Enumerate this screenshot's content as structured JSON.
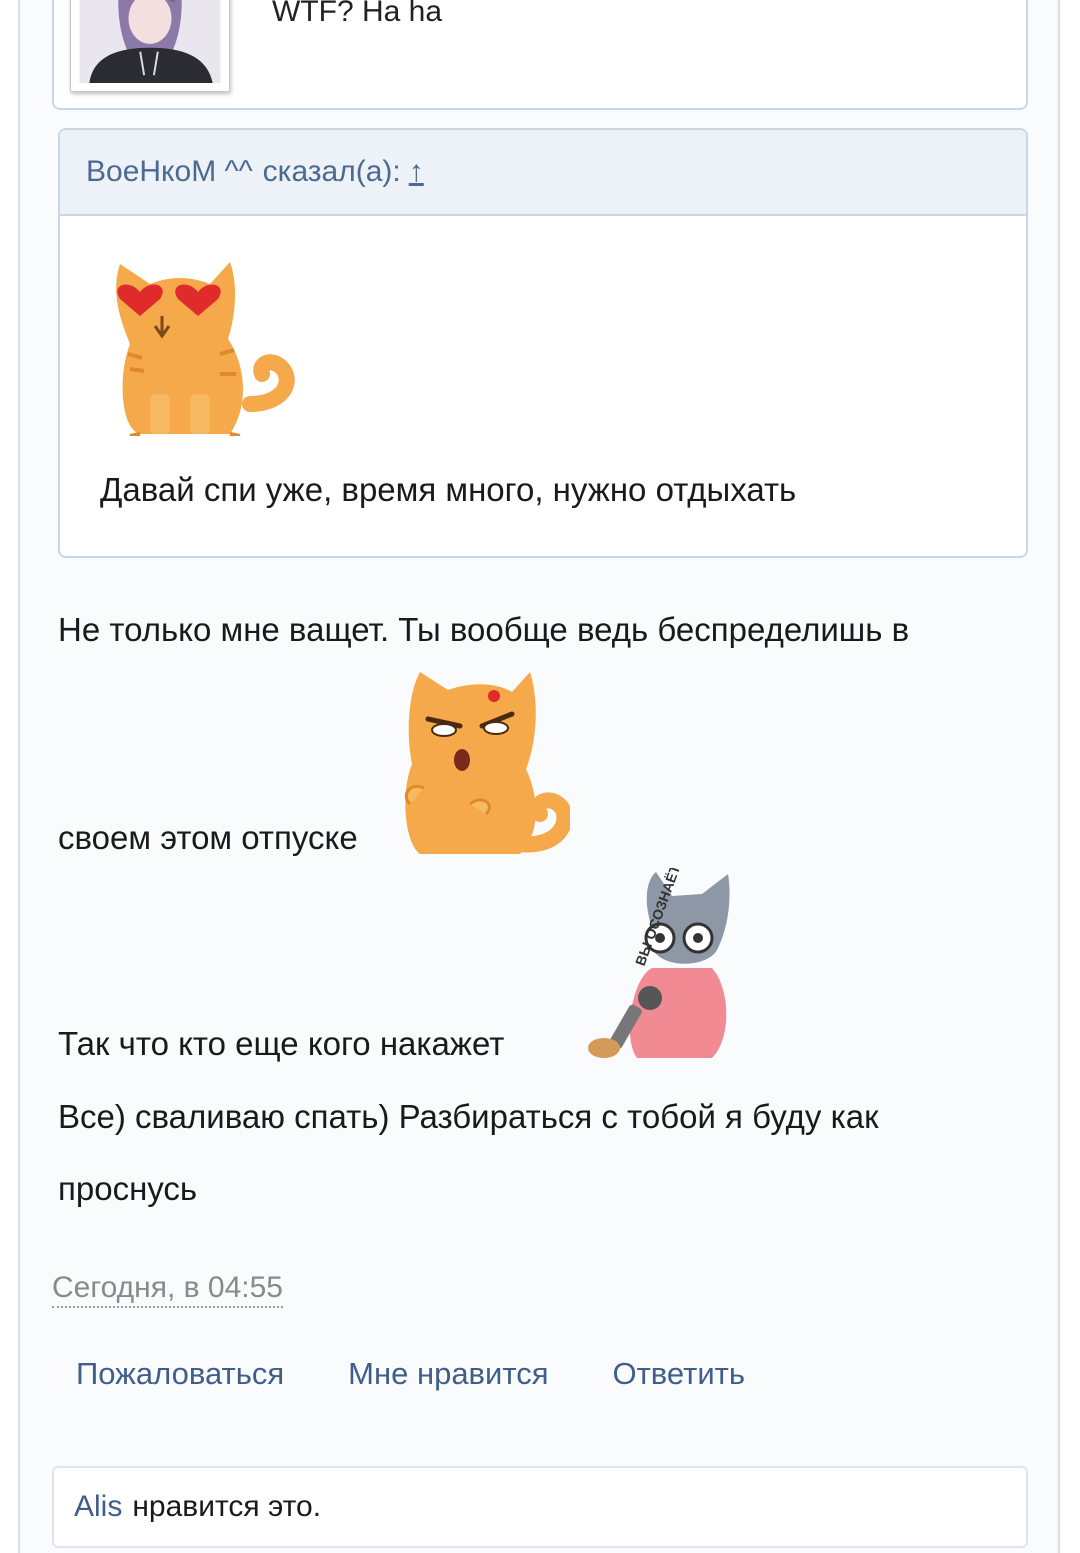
{
  "top_quote": {
    "text": "WTF? Ha ha"
  },
  "quote": {
    "author": "ВоеНкоМ ^^",
    "said": "сказал(а):",
    "jump_link": "↑",
    "text": "Давай спи уже, время много, нужно отдыхать"
  },
  "message": {
    "line1": "Не только мне ващет. Ты вообще ведь беспределишь в",
    "line2": "своем этом отпуске",
    "line3": "Так что кто еще кого накажет",
    "line4": "Все) сваливаю спать) Разбираться с тобой я буду как",
    "line5": "проснусь"
  },
  "sticker_gray": {
    "caption": "ВЫ ОСОЗНАЁТЕ?"
  },
  "timestamp": "Сегодня, в 04:55",
  "actions": {
    "report": "Пожаловаться",
    "like": "Мне нравится",
    "reply": "Ответить"
  },
  "likes": {
    "user": "Alis",
    "text": "нравится это."
  },
  "colors": {
    "link": "#3f5f8a",
    "quote_header_bg": "#edf2f8",
    "border": "#c9d6e5",
    "cat_orange": "#f5a94a"
  }
}
